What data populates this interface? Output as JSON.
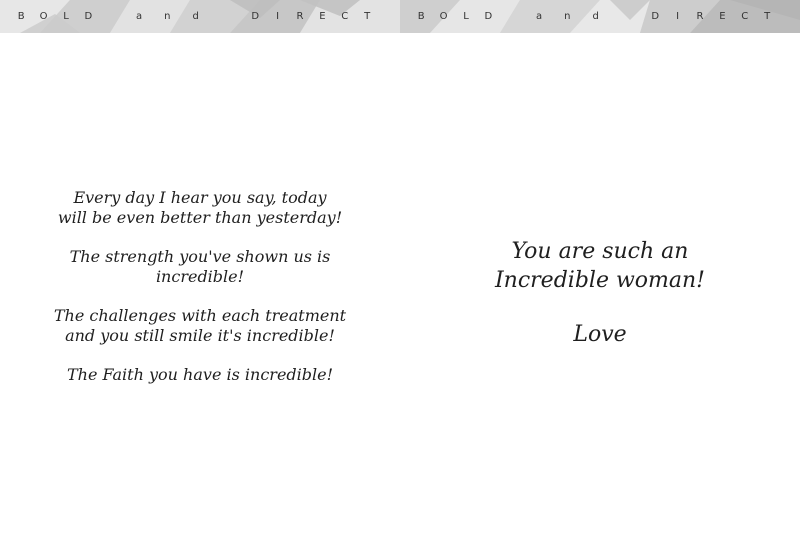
{
  "banner": {
    "left": {
      "word1": "BOLD",
      "word2": "and",
      "word3": "DIRECT"
    },
    "right": {
      "word1": "BOLD",
      "word2": "and",
      "word3": "DIRECT"
    },
    "colors": {
      "light": "#e6e6e6",
      "mid": "#cfcfcf",
      "dark": "#bdbdbd",
      "text": "#333333"
    }
  },
  "left_page": {
    "stanzas": [
      {
        "lines": [
          "Every day I hear you say, today",
          "will be even better than yesterday!"
        ]
      },
      {
        "lines": [
          "The strength you've shown us is",
          "incredible!"
        ]
      },
      {
        "lines": [
          "The challenges with each treatment",
          "and you still smile it's incredible!"
        ]
      },
      {
        "lines": [
          "The Faith you have is incredible!"
        ]
      }
    ]
  },
  "right_page": {
    "message_lines": [
      "You are such an",
      "Incredible woman!"
    ],
    "closing": "Love"
  }
}
